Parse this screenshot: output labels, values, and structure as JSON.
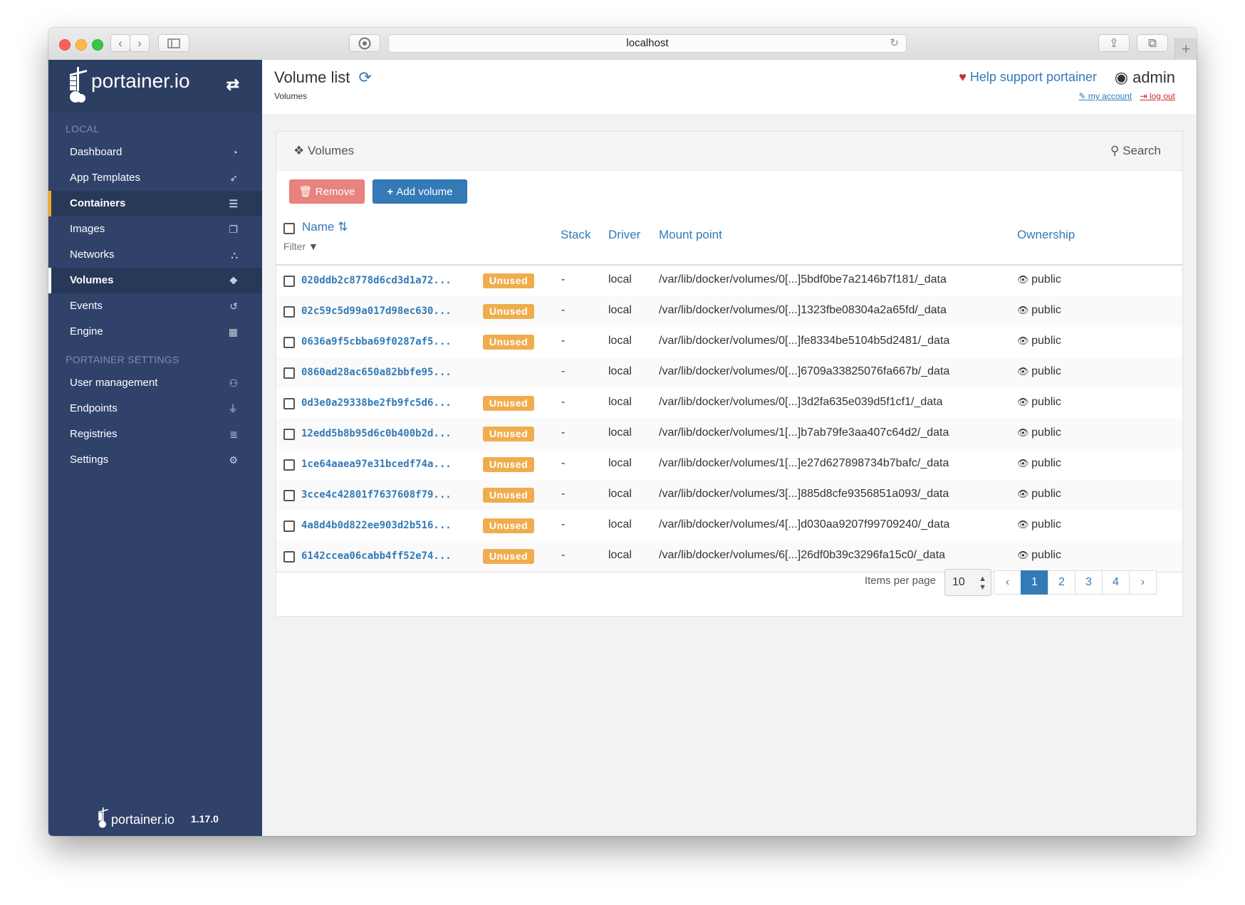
{
  "browser": {
    "url": "localhost",
    "back_icon": "chevron-left-icon",
    "forward_icon": "chevron-right-icon"
  },
  "sidebar": {
    "logo_text": "portainer.io",
    "section_local": "LOCAL",
    "section_settings": "PORTAINER SETTINGS",
    "items": [
      {
        "label": "Dashboard",
        "icon": "tachometer-icon"
      },
      {
        "label": "App Templates",
        "icon": "rocket-icon"
      },
      {
        "label": "Containers",
        "icon": "server-icon"
      },
      {
        "label": "Images",
        "icon": "clone-icon"
      },
      {
        "label": "Networks",
        "icon": "sitemap-icon"
      },
      {
        "label": "Volumes",
        "icon": "cubes-icon"
      },
      {
        "label": "Events",
        "icon": "history-icon"
      },
      {
        "label": "Engine",
        "icon": "th-icon"
      }
    ],
    "settings_items": [
      {
        "label": "User management",
        "icon": "users-icon"
      },
      {
        "label": "Endpoints",
        "icon": "plug-icon"
      },
      {
        "label": "Registries",
        "icon": "database-icon"
      },
      {
        "label": "Settings",
        "icon": "cogs-icon"
      }
    ],
    "footer_logo": "portainer.io",
    "version": "1.17.0"
  },
  "header": {
    "title": "Volume list",
    "breadcrumb": "Volumes",
    "help_link": "Help support portainer",
    "username": "admin",
    "my_account": "my account",
    "log_out": "log out"
  },
  "panel": {
    "title": "Volumes",
    "search_label": "Search",
    "remove_label": "Remove",
    "add_label": "Add volume",
    "columns": {
      "name": "Name",
      "filter": "Filter",
      "stack": "Stack",
      "driver": "Driver",
      "mount": "Mount point",
      "ownership": "Ownership"
    },
    "rows": [
      {
        "id": "020ddb2c8778d6cd3d1a72...",
        "badge": "Unused",
        "stack": "-",
        "driver": "local",
        "mount": "/var/lib/docker/volumes/0[...]5bdf0be7a2146b7f181/_data",
        "owner": "public"
      },
      {
        "id": "02c59c5d99a017d98ec630...",
        "badge": "Unused",
        "stack": "-",
        "driver": "local",
        "mount": "/var/lib/docker/volumes/0[...]1323fbe08304a2a65fd/_data",
        "owner": "public"
      },
      {
        "id": "0636a9f5cbba69f0287af5...",
        "badge": "Unused",
        "stack": "-",
        "driver": "local",
        "mount": "/var/lib/docker/volumes/0[...]fe8334be5104b5d2481/_data",
        "owner": "public"
      },
      {
        "id": "0860ad28ac650a82bbfe95...",
        "badge": "",
        "stack": "-",
        "driver": "local",
        "mount": "/var/lib/docker/volumes/0[...]6709a33825076fa667b/_data",
        "owner": "public"
      },
      {
        "id": "0d3e0a29338be2fb9fc5d6...",
        "badge": "Unused",
        "stack": "-",
        "driver": "local",
        "mount": "/var/lib/docker/volumes/0[...]3d2fa635e039d5f1cf1/_data",
        "owner": "public"
      },
      {
        "id": "12edd5b8b95d6c0b400b2d...",
        "badge": "Unused",
        "stack": "-",
        "driver": "local",
        "mount": "/var/lib/docker/volumes/1[...]b7ab79fe3aa407c64d2/_data",
        "owner": "public"
      },
      {
        "id": "1ce64aaea97e31bcedf74a...",
        "badge": "Unused",
        "stack": "-",
        "driver": "local",
        "mount": "/var/lib/docker/volumes/1[...]e27d627898734b7bafc/_data",
        "owner": "public"
      },
      {
        "id": "3cce4c42801f7637608f79...",
        "badge": "Unused",
        "stack": "-",
        "driver": "local",
        "mount": "/var/lib/docker/volumes/3[...]885d8cfe9356851a093/_data",
        "owner": "public"
      },
      {
        "id": "4a8d4b0d822ee903d2b516...",
        "badge": "Unused",
        "stack": "-",
        "driver": "local",
        "mount": "/var/lib/docker/volumes/4[...]d030aa9207f99709240/_data",
        "owner": "public"
      },
      {
        "id": "6142ccea06cabb4ff52e74...",
        "badge": "Unused",
        "stack": "-",
        "driver": "local",
        "mount": "/var/lib/docker/volumes/6[...]26df0b39c3296fa15c0/_data",
        "owner": "public"
      }
    ],
    "items_per_page_label": "Items per page",
    "items_per_page_value": "10",
    "pages": [
      "‹",
      "1",
      "2",
      "3",
      "4",
      "›"
    ],
    "active_page": "1"
  },
  "colors": {
    "sidebar_bg": "#30426a",
    "accent": "#337ab7",
    "badge_unused": "#f0ad4e",
    "remove_button": "#e8837f"
  }
}
